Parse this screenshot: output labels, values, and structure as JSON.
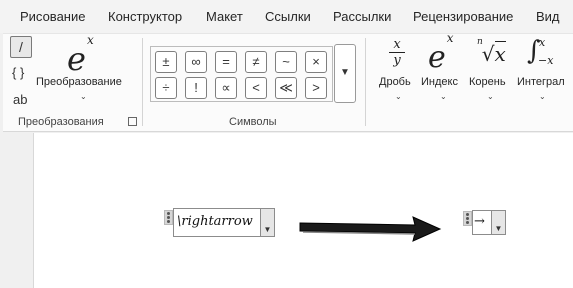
{
  "tabs": [
    "Рисование",
    "Конструктор",
    "Макет",
    "Ссылки",
    "Рассылки",
    "Рецензирование",
    "Вид"
  ],
  "ribbon": {
    "conversions": {
      "linear_label": "/",
      "braces_label": "{ }",
      "text_label": "ab",
      "convert_icon": "e",
      "convert_icon_sup": "x",
      "convert_label": "Преобразование",
      "group_label": "Преобразования"
    },
    "symbols": {
      "row1": [
        "±",
        "∞",
        "=",
        "≠",
        "~",
        "×"
      ],
      "row2": [
        "÷",
        "!",
        "∝",
        "<",
        "≪",
        ">"
      ],
      "group_label": "Символы"
    },
    "structures": {
      "fraction_label": "Дробь",
      "script_label": "Индекс",
      "radical_label": "Корень",
      "integral_label": "Интеграл"
    }
  },
  "document": {
    "equation_input": "\\rightarrow",
    "equation_result": "→"
  },
  "colors": {
    "ribbon_bg": "#fbfbfb",
    "tabs_bg": "#f3f3f3",
    "document_bg": "#ffffff",
    "arrow": "#1a1a1a"
  }
}
